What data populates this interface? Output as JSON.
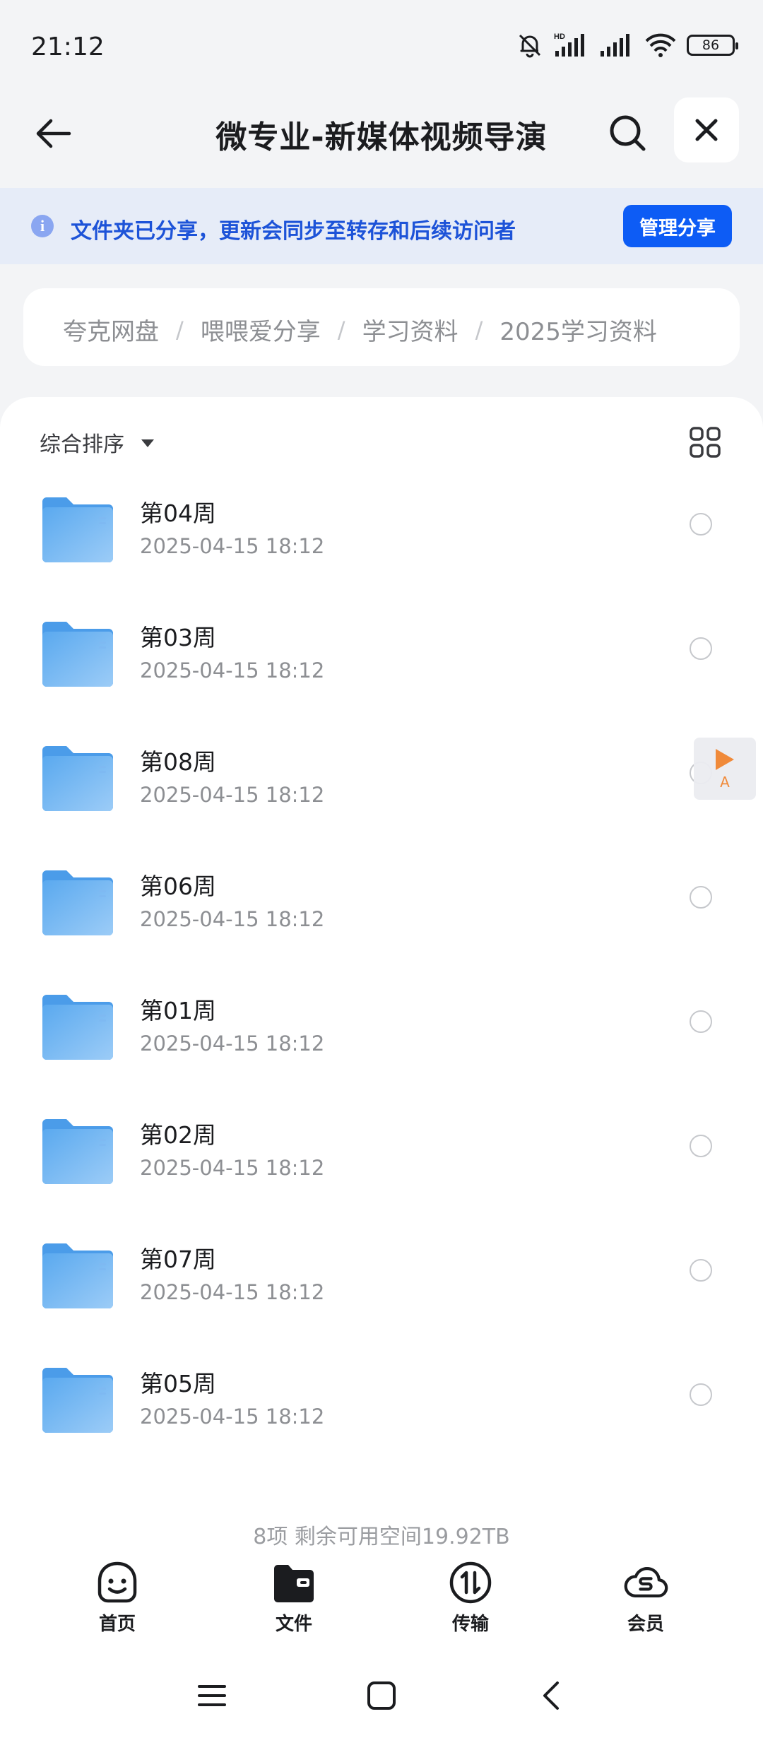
{
  "status_bar": {
    "time": "21:12",
    "battery": "86",
    "hd_label": "HD"
  },
  "header": {
    "title": "微专业-新媒体视频导演"
  },
  "share_banner": {
    "text": "文件夹已分享，更新会同步至转存和后续访问者",
    "manage_label": "管理分享"
  },
  "breadcrumb": [
    "夸克网盘",
    "喂喂爱分享",
    "学习资料",
    "2025学习资料"
  ],
  "breadcrumb_separator": "/",
  "toolbar": {
    "sort_label": "综合排序"
  },
  "files": [
    {
      "name": "第04周",
      "date": "2025-04-15 18:12"
    },
    {
      "name": "第03周",
      "date": "2025-04-15 18:12"
    },
    {
      "name": "第08周",
      "date": "2025-04-15 18:12"
    },
    {
      "name": "第06周",
      "date": "2025-04-15 18:12"
    },
    {
      "name": "第01周",
      "date": "2025-04-15 18:12"
    },
    {
      "name": "第02周",
      "date": "2025-04-15 18:12"
    },
    {
      "name": "第07周",
      "date": "2025-04-15 18:12"
    },
    {
      "name": "第05周",
      "date": "2025-04-15 18:12"
    }
  ],
  "float_player": {
    "label": "A"
  },
  "footer": {
    "summary": "8项 剩余可用空间19.92TB"
  },
  "tabs": [
    {
      "label": "首页",
      "icon": "smile-face-icon"
    },
    {
      "label": "文件",
      "icon": "folder-icon"
    },
    {
      "label": "传输",
      "icon": "transfer-icon"
    },
    {
      "label": "会员",
      "icon": "cloud-member-icon"
    }
  ],
  "colors": {
    "accent": "#0d5cf5",
    "banner_bg": "#e6ecf8",
    "banner_text": "#1d53d8",
    "folder": "#5aa9ef",
    "page_bg": "#f3f4f6"
  }
}
